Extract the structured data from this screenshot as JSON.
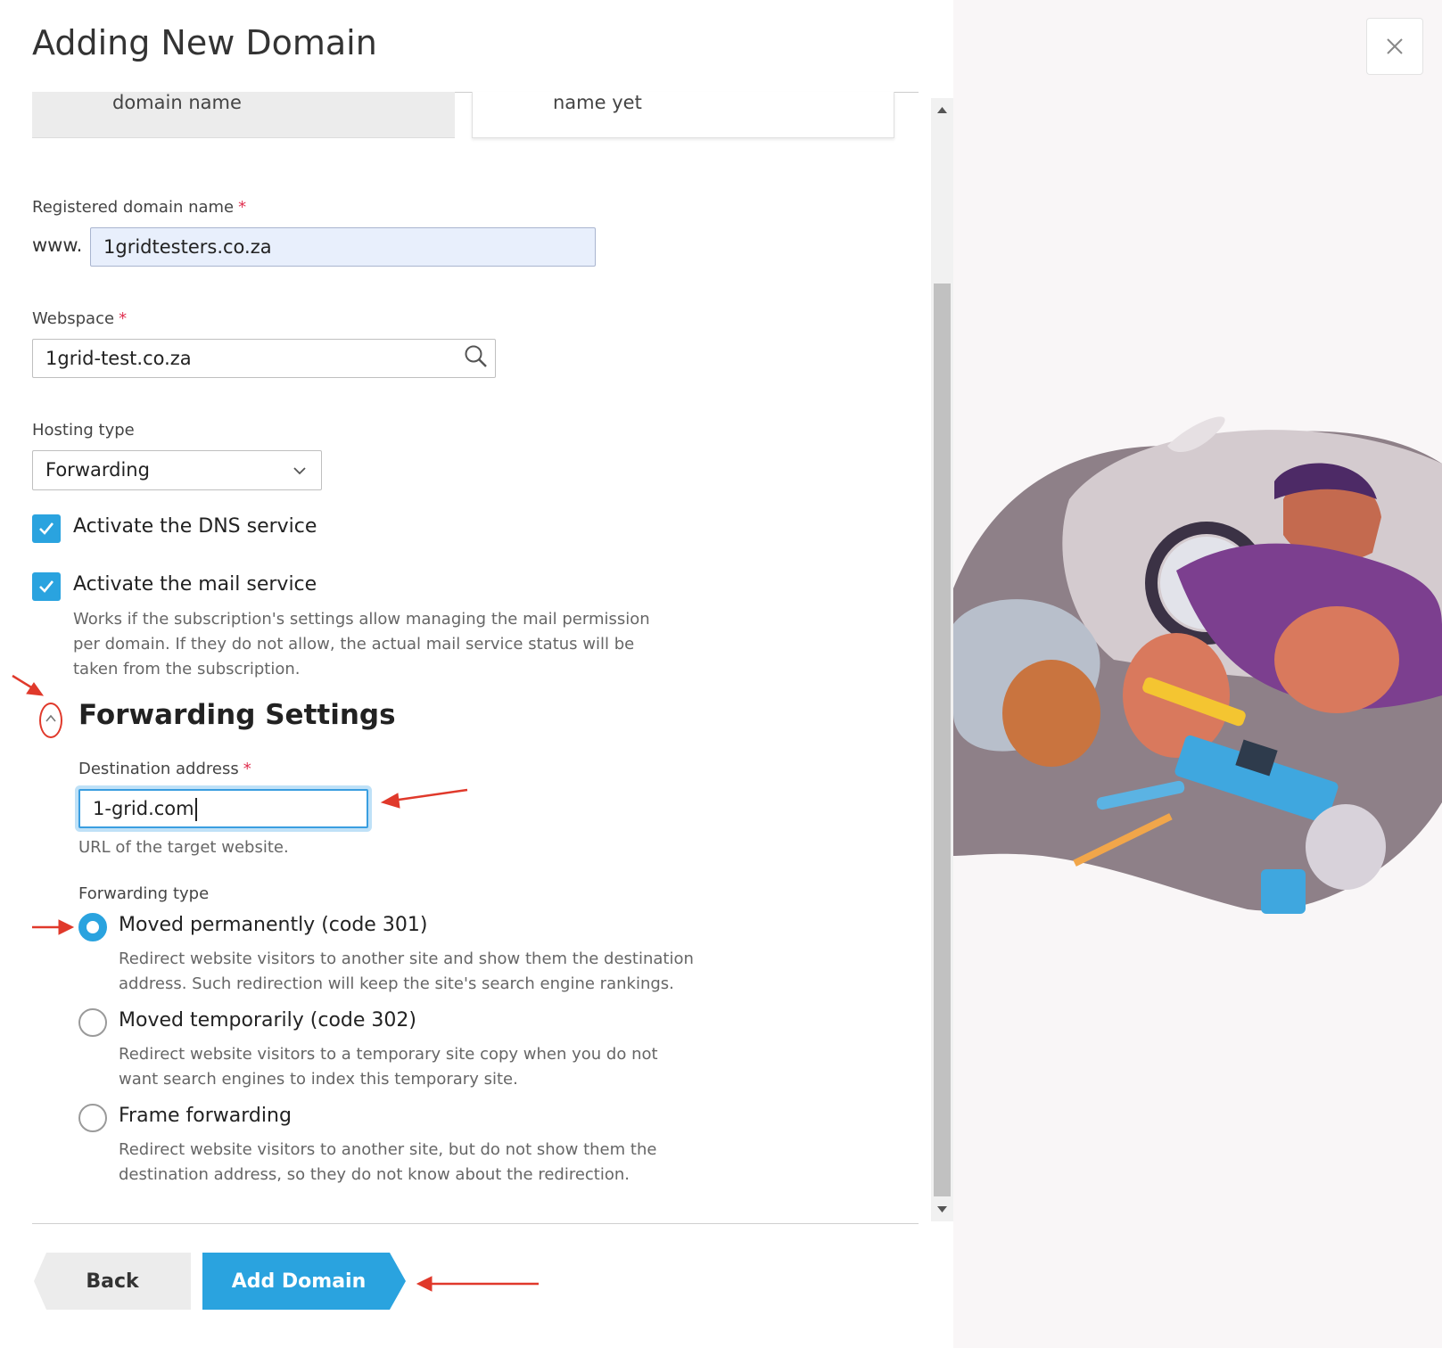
{
  "title": "Adding New Domain",
  "top_cards": {
    "left_label": "domain name",
    "right_label": "name yet"
  },
  "registered_domain": {
    "label": "Registered domain name",
    "prefix": "www.",
    "value": "1gridtesters.co.za"
  },
  "webspace": {
    "label": "Webspace",
    "value": "1grid-test.co.za"
  },
  "hosting_type": {
    "label": "Hosting type",
    "value": "Forwarding"
  },
  "dns_service": {
    "label": "Activate the DNS service",
    "checked": true
  },
  "mail_service": {
    "label": "Activate the mail service",
    "checked": true,
    "hint_lines": [
      "Works if the subscription's settings allow managing the mail permission",
      "per domain. If they do not allow, the actual mail service status will be",
      "taken from the subscription."
    ]
  },
  "forwarding_settings": {
    "title": "Forwarding Settings",
    "destination": {
      "label": "Destination address",
      "value": "1-grid.com",
      "hint": "URL of the target website."
    },
    "forwarding_type": {
      "label": "Forwarding type",
      "options": [
        {
          "label": "Moved permanently (code 301)",
          "checked": true,
          "desc_lines": [
            "Redirect website visitors to another site and show them the destination",
            "address. Such redirection will keep the site's search engine rankings."
          ]
        },
        {
          "label": "Moved temporarily (code 302)",
          "checked": false,
          "desc_lines": [
            "Redirect website visitors to a temporary site copy when you do not",
            "want search engines to index this temporary site."
          ]
        },
        {
          "label": "Frame forwarding",
          "checked": false,
          "desc_lines": [
            "Redirect website visitors to another site, but do not show them the",
            "destination address, so they do not know about the redirection."
          ]
        }
      ]
    }
  },
  "buttons": {
    "back": "Back",
    "add_domain": "Add Domain"
  },
  "colors": {
    "accent": "#2aa3df",
    "required": "#e03050",
    "annotation": "#e0392b"
  },
  "icons": {
    "close": "close-icon",
    "search": "search-icon",
    "dropdown": "chevron-down-icon",
    "check": "check-icon",
    "collapse": "chevron-up-icon"
  }
}
